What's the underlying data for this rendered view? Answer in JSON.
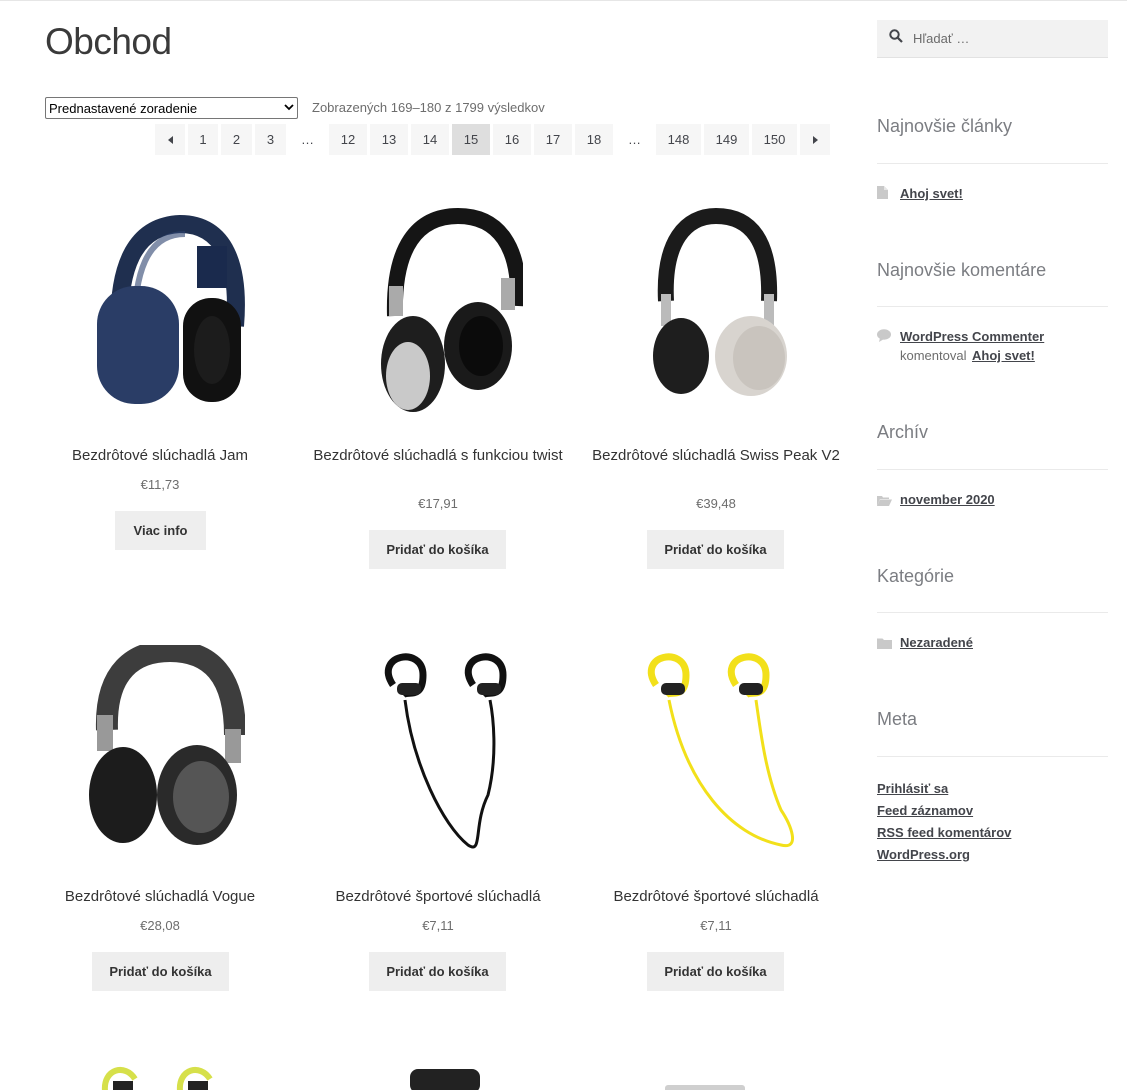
{
  "page": {
    "title": "Obchod"
  },
  "toolbar": {
    "orderby_selected": "Prednastavené zoradenie",
    "result_count": "Zobrazených 169–180 z 1799 výsledkov"
  },
  "pagination": {
    "items": [
      "1",
      "2",
      "3",
      "…",
      "12",
      "13",
      "14",
      "15",
      "16",
      "17",
      "18",
      "…",
      "148",
      "149",
      "150"
    ],
    "current": "15"
  },
  "products": [
    {
      "title": "Bezdrôtové slúchadlá Jam",
      "price": "€11,73",
      "button": "Viac info"
    },
    {
      "title": "Bezdrôtové slúchadlá s funkciou twist",
      "price": "€17,91",
      "button": "Pridať do košíka"
    },
    {
      "title": "Bezdrôtové slúchadlá Swiss Peak V2",
      "price": "€39,48",
      "button": "Pridať do košíka"
    },
    {
      "title": "Bezdrôtové slúchadlá Vogue",
      "price": "€28,08",
      "button": "Pridať do košíka"
    },
    {
      "title": "Bezdrôtové športové slúchadlá",
      "price": "€7,11",
      "button": "Pridať do košíka"
    },
    {
      "title": "Bezdrôtové športové slúchadlá",
      "price": "€7,11",
      "button": "Pridať do košíka"
    }
  ],
  "sidebar": {
    "search_placeholder": "Hľadať …",
    "recent_posts": {
      "title": "Najnovšie články",
      "items": [
        "Ahoj svet!"
      ]
    },
    "recent_comments": {
      "title": "Najnovšie komentáre",
      "author": "WordPress Commenter",
      "verb": "komentoval",
      "post": "Ahoj svet!"
    },
    "archive": {
      "title": "Archív",
      "items": [
        "november 2020"
      ]
    },
    "categories": {
      "title": "Kategórie",
      "items": [
        "Nezaradené"
      ]
    },
    "meta": {
      "title": "Meta",
      "items": [
        "Prihlásiť sa",
        "Feed záznamov",
        "RSS feed komentárov",
        "WordPress.org"
      ]
    }
  },
  "icons": [
    "search-icon",
    "document-icon",
    "comment-icon",
    "folder-icon",
    "caret-left-icon",
    "caret-right-icon"
  ]
}
